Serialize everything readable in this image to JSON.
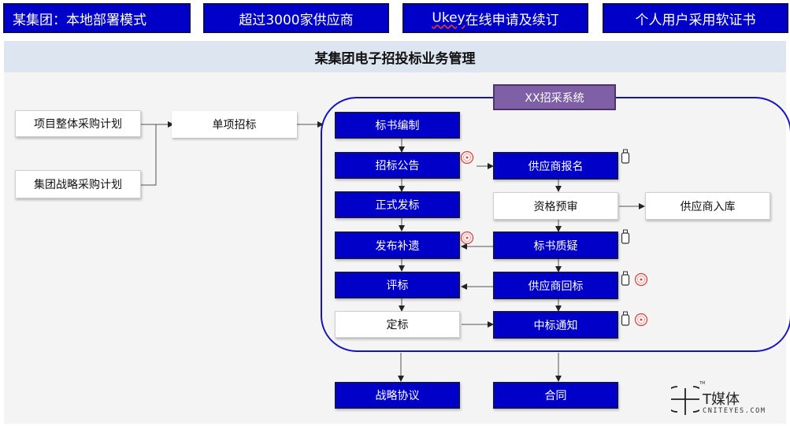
{
  "top_bar": {
    "items": [
      {
        "label": "某集团：本地部署模式"
      },
      {
        "label": "超过3000家供应商"
      },
      {
        "label_prefix": "Ukey",
        "label_suffix": "在线申请及续订"
      },
      {
        "label": "个人用户采用软证书"
      }
    ]
  },
  "title": "某集团电子招投标业务管理",
  "left_flow": {
    "plan_overall": "项目整体采购计划",
    "plan_strategy": "集团战略采购计划",
    "single_tender": "单项招标"
  },
  "system": {
    "label": "XX招采系统",
    "left_column": [
      "标书编制",
      "招标公告",
      "正式发标",
      "发布补遗",
      "评标",
      "定标"
    ],
    "right_column": [
      "供应商报名",
      "资格预审",
      "标书质疑",
      "供应商回标",
      "中标通知"
    ],
    "side_box": "供应商入库"
  },
  "outputs": {
    "agreement": "战略协议",
    "contract": "合同"
  },
  "logo": {
    "name": "T媒体",
    "site": "CNITEYES.COM",
    "tm": "TM"
  },
  "colors": {
    "primary_blue": "#0000c8",
    "frame_blue": "#1515c0",
    "system_purple": "#7f5fa6",
    "seal_red": "#e53935",
    "title_band": "#dde5f1"
  }
}
